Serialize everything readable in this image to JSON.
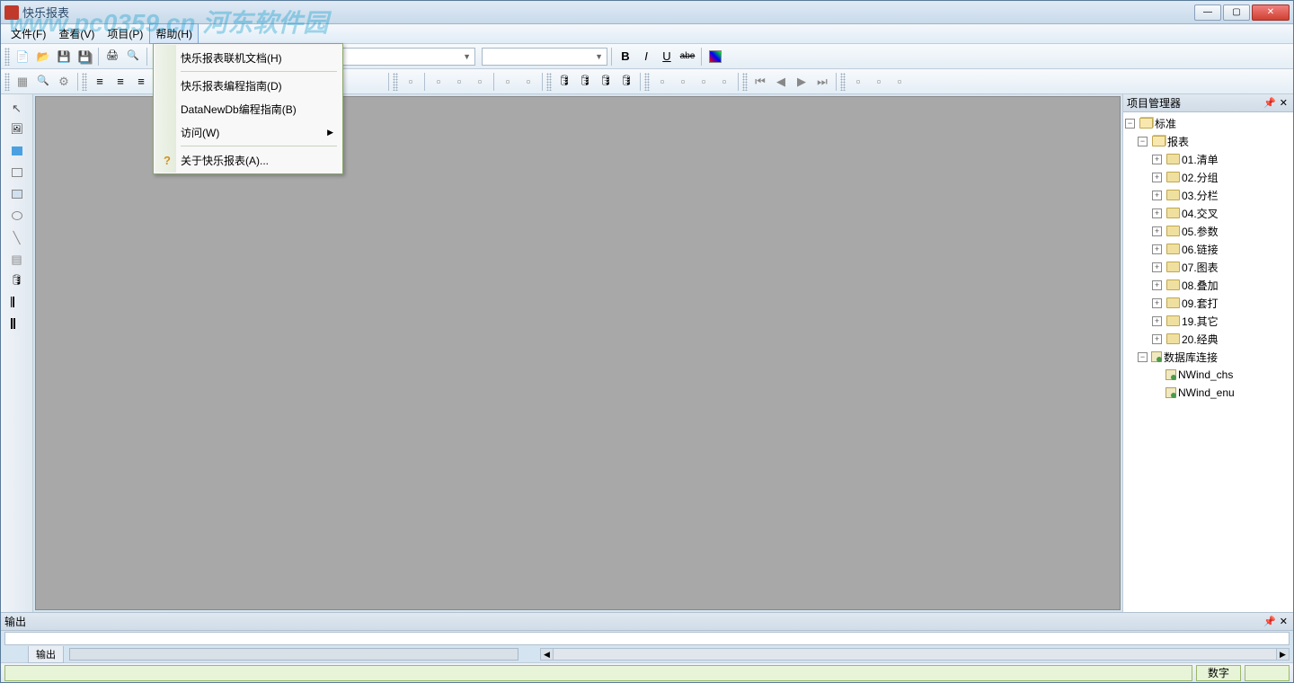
{
  "app": {
    "title": "快乐报表",
    "watermark": "www.pc0359.cn 河东软件园"
  },
  "menubar": {
    "file": "文件(F)",
    "view": "查看(V)",
    "project": "项目(P)",
    "help": "帮助(H)"
  },
  "help_menu": {
    "online_doc": "快乐报表联机文档(H)",
    "prog_guide": "快乐报表编程指南(D)",
    "datanewdb_guide": "DataNewDb编程指南(B)",
    "visit": "访问(W)",
    "about": "关于快乐报表(A)..."
  },
  "toolbar1": {
    "font_name": "",
    "font_size": ""
  },
  "project_panel": {
    "title": "项目管理器",
    "root": "标准",
    "reports": "报表",
    "folders": [
      "01.清单",
      "02.分组",
      "03.分栏",
      "04.交叉",
      "05.参数",
      "06.链接",
      "07.图表",
      "08.叠加",
      "09.套打",
      "19.其它",
      "20.经典"
    ],
    "db_conn": "数据库连接",
    "db_items": [
      "NWind_chs",
      "NWind_enu"
    ]
  },
  "output_panel": {
    "title": "输出",
    "tab": "输出"
  },
  "statusbar": {
    "numlock": "数字"
  },
  "window_controls": {
    "min": "—",
    "max": "▢",
    "close": "✕"
  }
}
